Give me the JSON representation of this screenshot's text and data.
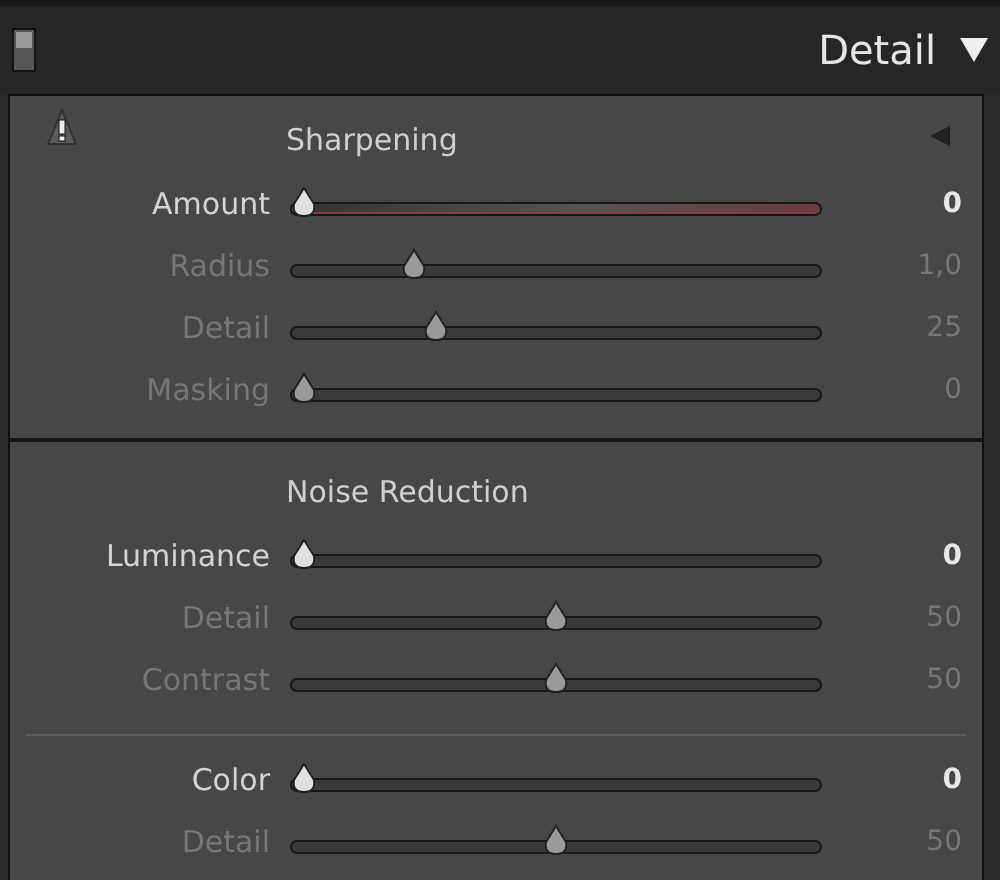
{
  "panel": {
    "title": "Detail",
    "expanded": true
  },
  "sections": [
    {
      "title": "Sharpening",
      "sliders": [
        {
          "label": "Amount",
          "value": "0",
          "level": 0,
          "enabled": true,
          "kind": "tinted"
        },
        {
          "label": "Radius",
          "value": "1,0",
          "level": 0.22,
          "enabled": false,
          "kind": "plain"
        },
        {
          "label": "Detail",
          "value": "25",
          "level": 0.26,
          "enabled": false,
          "kind": "plain"
        },
        {
          "label": "Masking",
          "value": "0",
          "level": 0,
          "enabled": false,
          "kind": "plain"
        }
      ]
    },
    {
      "title": "Noise Reduction",
      "sliders": [
        {
          "label": "Luminance",
          "value": "0",
          "level": 0,
          "enabled": true,
          "kind": "plain"
        },
        {
          "label": "Detail",
          "value": "50",
          "level": 0.5,
          "enabled": false,
          "kind": "plain"
        },
        {
          "label": "Contrast",
          "value": "50",
          "level": 0.5,
          "enabled": false,
          "kind": "plain"
        }
      ]
    },
    {
      "sliders": [
        {
          "label": "Color",
          "value": "0",
          "level": 0,
          "enabled": true,
          "kind": "plain"
        },
        {
          "label": "Detail",
          "value": "50",
          "level": 0.5,
          "enabled": false,
          "kind": "plain"
        }
      ]
    }
  ]
}
